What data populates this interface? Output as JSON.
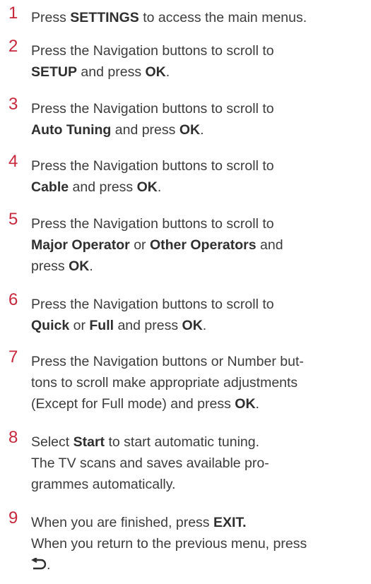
{
  "steps": [
    {
      "number": "1",
      "lines": [
        [
          {
            "t": "Press "
          },
          {
            "t": "SETTINGS",
            "b": true
          },
          {
            "t": " to access the main menus."
          }
        ]
      ]
    },
    {
      "number": "2",
      "lines": [
        [
          {
            "t": "Press the Navigation buttons to scroll to"
          }
        ],
        [
          {
            "t": "SETUP",
            "b": true
          },
          {
            "t": " and press "
          },
          {
            "t": "OK",
            "b": true
          },
          {
            "t": "."
          }
        ]
      ]
    },
    {
      "number": "3",
      "lines": [
        [
          {
            "t": "Press the Navigation buttons to scroll to"
          }
        ],
        [
          {
            "t": "Auto Tuning",
            "b": true
          },
          {
            "t": " and press "
          },
          {
            "t": "OK",
            "b": true
          },
          {
            "t": "."
          }
        ]
      ]
    },
    {
      "number": "4",
      "lines": [
        [
          {
            "t": "Press the Navigation buttons to scroll to"
          }
        ],
        [
          {
            "t": "Cable",
            "b": true
          },
          {
            "t": " and press "
          },
          {
            "t": "OK",
            "b": true
          },
          {
            "t": "."
          }
        ]
      ]
    },
    {
      "number": "5",
      "lines": [
        [
          {
            "t": "Press the Navigation buttons to scroll to"
          }
        ],
        [
          {
            "t": "Major Operator",
            "b": true
          },
          {
            "t": " or "
          },
          {
            "t": "Other Operators",
            "b": true
          },
          {
            "t": " and"
          }
        ],
        [
          {
            "t": "press "
          },
          {
            "t": "OK",
            "b": true
          },
          {
            "t": "."
          }
        ]
      ]
    },
    {
      "number": "6",
      "lines": [
        [
          {
            "t": "Press the Navigation buttons to scroll to"
          }
        ],
        [
          {
            "t": "Quick",
            "b": true
          },
          {
            "t": " or "
          },
          {
            "t": "Full",
            "b": true
          },
          {
            "t": " and press "
          },
          {
            "t": "OK",
            "b": true
          },
          {
            "t": "."
          }
        ]
      ]
    },
    {
      "number": "7",
      "lines": [
        [
          {
            "t": "Press the Navigation buttons or Number but-"
          }
        ],
        [
          {
            "t": "tons to scroll make appropriate adjustments"
          }
        ],
        [
          {
            "t": "(Except for Full mode) and press "
          },
          {
            "t": "OK",
            "b": true
          },
          {
            "t": "."
          }
        ]
      ]
    },
    {
      "number": "8",
      "lines": [
        [
          {
            "t": "Select "
          },
          {
            "t": "Start",
            "b": true
          },
          {
            "t": " to start automatic tuning."
          }
        ],
        [
          {
            "t": "The TV scans and saves available pro-"
          }
        ],
        [
          {
            "t": "grammes automatically."
          }
        ]
      ]
    },
    {
      "number": "9",
      "lines": [
        [
          {
            "t": "When you are finished, press "
          },
          {
            "t": "EXIT.",
            "b": true
          }
        ],
        [
          {
            "t": "When you return to the previous menu, press"
          }
        ],
        [
          {
            "icon": "return-icon"
          },
          {
            "t": "."
          }
        ]
      ]
    }
  ],
  "colors": {
    "step_number": "#c8283c",
    "text": "#3c3c3c"
  }
}
